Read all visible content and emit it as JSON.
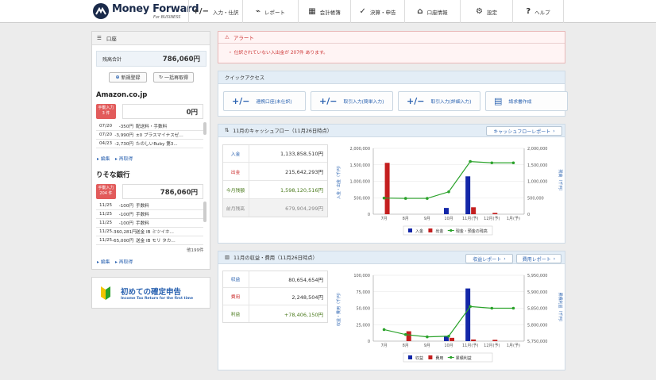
{
  "brand": {
    "name": "Money Forward",
    "sub": "For BUSINESS"
  },
  "nav": [
    {
      "icon": "+/−",
      "label": "入力・仕訳",
      "w": 68
    },
    {
      "icon": "⌁",
      "label": "レポート",
      "w": 70
    },
    {
      "icon": "▦",
      "label": "会計帳簿",
      "w": 66
    },
    {
      "icon": "✓",
      "label": "決算・申告",
      "w": 68
    },
    {
      "icon": "⌂",
      "label": "口座情報",
      "w": 70
    },
    {
      "icon": "⚙",
      "label": "設定",
      "w": 66
    },
    {
      "icon": "?",
      "label": "ヘルプ",
      "w": 65
    }
  ],
  "sidebar": {
    "title": "口座",
    "total_label": "残高合計",
    "total_amount": "786,060円",
    "new_button": "新規登録",
    "refresh_button": "一括再取得",
    "accounts": [
      {
        "name": "Amazon.co.jp",
        "badge": "手動入力\n3 件",
        "balance": "0円",
        "rows": [
          {
            "d": "07/20",
            "a": "-350円",
            "n": "配送料・手数料"
          },
          {
            "d": "07/20",
            "a": "-3,990円",
            "n": "±0 プラスマイナスゼ..."
          },
          {
            "d": "04/23",
            "a": "-2,730円",
            "n": "たのしいRuby 第3..."
          }
        ],
        "edit": "編集",
        "refetch": "再取得"
      },
      {
        "name": "りそな銀行",
        "badge": "手動入力\n204 件",
        "balance": "786,060円",
        "rows": [
          {
            "d": "11/25",
            "a": "-100円",
            "n": "手数料"
          },
          {
            "d": "11/25",
            "a": "-100円",
            "n": "手数料"
          },
          {
            "d": "11/25",
            "a": "-100円",
            "n": "手数料"
          },
          {
            "d": "11/25",
            "a": "-360,281円",
            "n": "送金 IB ミツイホ..."
          },
          {
            "d": "11/25",
            "a": "-65,000円",
            "n": "送金 IB モリ タカ..."
          }
        ],
        "more": "他199件",
        "edit": "編集",
        "refetch": "再取得"
      }
    ],
    "banner_title": "初めての確定申告",
    "banner_sub": "Income Tax Return for the first time"
  },
  "alert": {
    "title": "アラート",
    "message": "・ 仕訳されていない入出金が 207件 あります。"
  },
  "quick": {
    "title": "クイックアクセス",
    "items": [
      {
        "icon": "+/−",
        "label": "連携口座(未仕訳)"
      },
      {
        "icon": "+/−",
        "label": "取引入力(簡単入力)"
      },
      {
        "icon": "+/−",
        "label": "取引入力(詳細入力)"
      },
      {
        "icon": "▤",
        "label": "請求書作成"
      }
    ]
  },
  "cashflow": {
    "title": "11月のキャッシュフロー（11月26日時点）",
    "report_button": "キャッシュフローレポート",
    "rows": [
      {
        "k": "入金",
        "v": "1,133,858,510円",
        "kc": "#2a62b0",
        "vc": "#333"
      },
      {
        "k": "出金",
        "v": "215,642,293円",
        "kc": "#c33",
        "vc": "#333"
      },
      {
        "k": "今月残額",
        "v": "1,598,120,516円",
        "kc": "#4a7a1c",
        "vc": "#4a7a1c"
      },
      {
        "k": "前月残高",
        "v": "679,904,299円",
        "kc": "#888",
        "vc": "#888"
      }
    ]
  },
  "pl": {
    "title": "11月の収益・費用（11月26日時点）",
    "report_button": "収益レポート",
    "report_button2": "費用レポート",
    "rows": [
      {
        "k": "収益",
        "v": "80,654,654円",
        "kc": "#2a62b0",
        "vc": "#333"
      },
      {
        "k": "費用",
        "v": "2,248,504円",
        "kc": "#c33",
        "vc": "#333"
      },
      {
        "k": "利益",
        "v": "+78,406,150円",
        "kc": "#4a7a1c",
        "vc": "#4a7a1c"
      }
    ]
  },
  "chart_data": [
    {
      "type": "bar",
      "categories": [
        "7月",
        "8月",
        "9月",
        "10月",
        "11月(予)",
        "12月(予)",
        "1月(予)"
      ],
      "yticks_left": [
        "0",
        "500,000",
        "1,000,000",
        "1,500,000",
        "2,000,000"
      ],
      "yticks_right": [
        "0",
        "500,000",
        "1,000,000",
        "1,500,000",
        "2,000,000"
      ],
      "ylabel_left": "入金・出金（千円）",
      "ylabel_right": "残高（千円）",
      "ylim": [
        0,
        2000000
      ],
      "series": [
        {
          "name": "入金",
          "color": "#1327a8",
          "values": [
            0,
            0,
            0,
            190000,
            1150000,
            0,
            0
          ]
        },
        {
          "name": "出金",
          "color": "#c41f1f",
          "values": [
            1560000,
            0,
            0,
            0,
            210000,
            40000,
            0
          ]
        },
        {
          "name": "現金・預金の残高",
          "color": "#2aa22a",
          "line": true,
          "values": [
            490000,
            480000,
            480000,
            680000,
            1600000,
            1560000,
            1560000
          ]
        }
      ]
    },
    {
      "type": "bar",
      "categories": [
        "7月",
        "8月",
        "9月",
        "10月",
        "11月(予)",
        "12月(予)",
        "1月(予)"
      ],
      "yticks_left": [
        "0",
        "25,000",
        "50,000",
        "75,000",
        "100,000"
      ],
      "yticks_right": [
        "5,750,000",
        "5,800,000",
        "5,850,000",
        "5,900,000",
        "5,950,000"
      ],
      "ylabel_left": "収益・費用（千円）",
      "ylabel_right": "累積利益（千円）",
      "ylim": [
        0,
        100000
      ],
      "ylim_right": [
        5750000,
        5950000
      ],
      "series": [
        {
          "name": "収益",
          "color": "#1327a8",
          "values": [
            0,
            0,
            0,
            8000,
            80000,
            0,
            0
          ]
        },
        {
          "name": "費用",
          "color": "#c41f1f",
          "values": [
            0,
            15000,
            0,
            5000,
            2500,
            2000,
            0
          ]
        },
        {
          "name": "累積利益",
          "color": "#2aa22a",
          "line": true,
          "values": [
            5785000,
            5770000,
            5763000,
            5765000,
            5855000,
            5850000,
            5850000
          ]
        }
      ]
    }
  ]
}
